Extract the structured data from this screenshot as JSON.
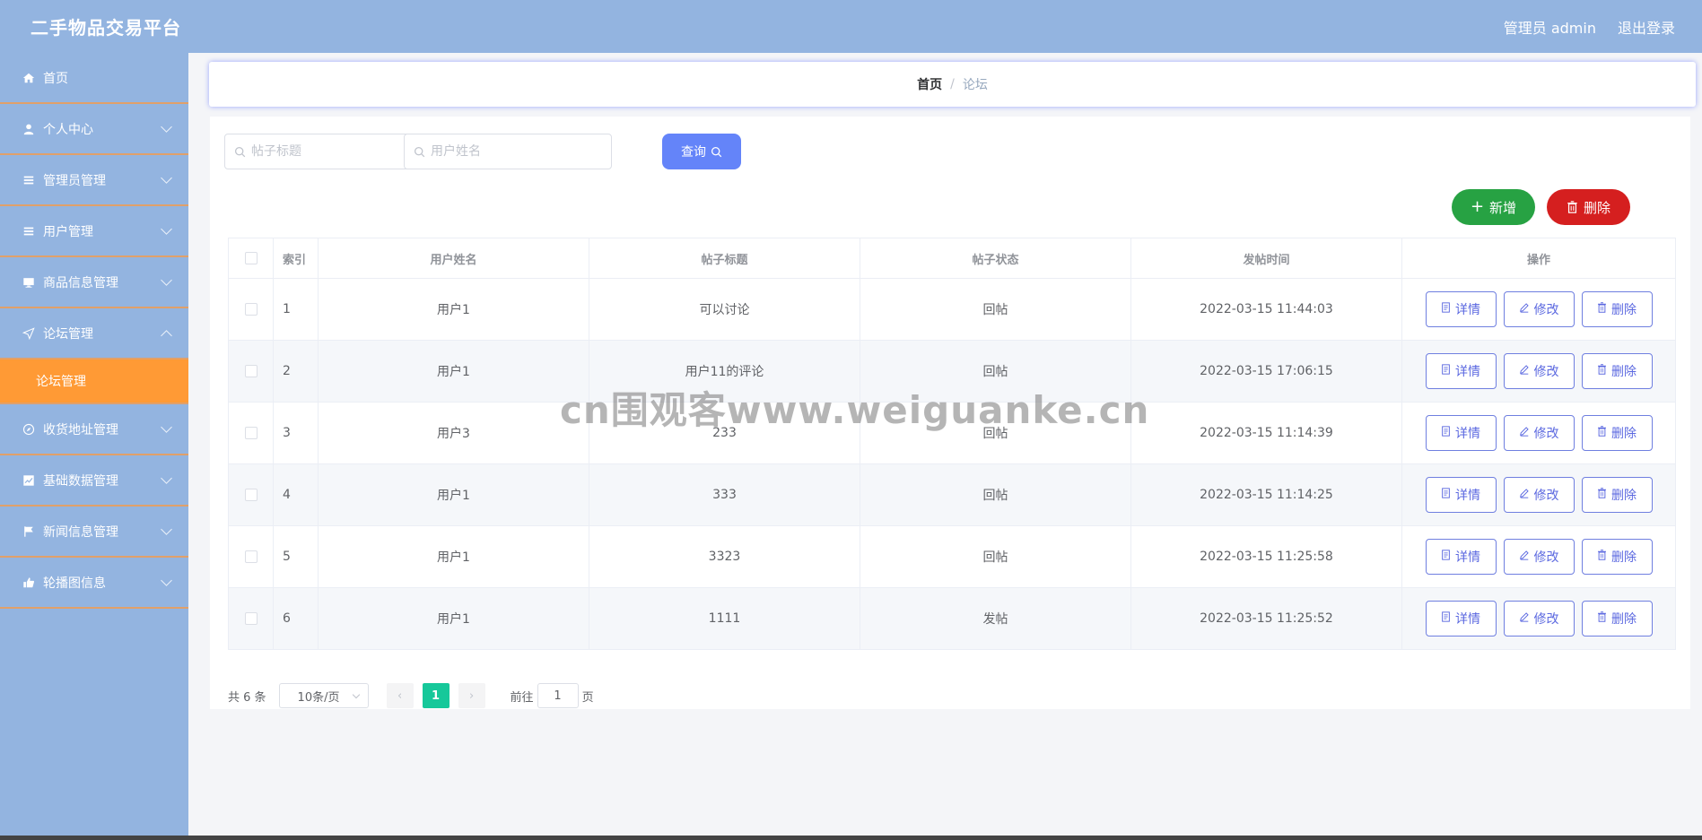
{
  "header": {
    "app_title": "二手物品交易平台",
    "user_label": "管理员 admin",
    "logout_label": "退出登录"
  },
  "sidebar": {
    "items": [
      {
        "label": "首页",
        "icon": "home-icon"
      },
      {
        "label": "个人中心",
        "icon": "user-icon"
      },
      {
        "label": "管理员管理",
        "icon": "list-icon"
      },
      {
        "label": "用户管理",
        "icon": "list-icon"
      },
      {
        "label": "商品信息管理",
        "icon": "monitor-icon"
      },
      {
        "label": "论坛管理",
        "icon": "send-icon",
        "expanded": true
      },
      {
        "label": "收货地址管理",
        "icon": "compass-icon"
      },
      {
        "label": "基础数据管理",
        "icon": "chart-icon"
      },
      {
        "label": "新闻信息管理",
        "icon": "flag-icon"
      },
      {
        "label": "轮播图信息",
        "icon": "thumb-icon"
      }
    ],
    "sub_item_active": "论坛管理"
  },
  "breadcrumb": {
    "home": "首页",
    "separator": "/",
    "current": "论坛"
  },
  "search": {
    "title_placeholder": "帖子标题",
    "user_placeholder": "用户姓名",
    "query_label": "查询"
  },
  "actions": {
    "add_label": "新增",
    "delete_label": "删除"
  },
  "table": {
    "headers": [
      "索引",
      "用户姓名",
      "帖子标题",
      "帖子状态",
      "发帖时间",
      "操作"
    ],
    "rows": [
      {
        "index": "1",
        "user": "用户1",
        "title": "可以讨论",
        "status": "回帖",
        "time": "2022-03-15 11:44:03"
      },
      {
        "index": "2",
        "user": "用户1",
        "title": "用户11的评论",
        "status": "回帖",
        "time": "2022-03-15 17:06:15"
      },
      {
        "index": "3",
        "user": "用户3",
        "title": "233",
        "status": "回帖",
        "time": "2022-03-15 11:14:39"
      },
      {
        "index": "4",
        "user": "用户1",
        "title": "333",
        "status": "回帖",
        "time": "2022-03-15 11:14:25"
      },
      {
        "index": "5",
        "user": "用户1",
        "title": "3323",
        "status": "回帖",
        "time": "2022-03-15 11:25:58"
      },
      {
        "index": "6",
        "user": "用户1",
        "title": "1111",
        "status": "发帖",
        "time": "2022-03-15 11:25:52"
      }
    ],
    "op_labels": {
      "detail": "详情",
      "edit": "修改",
      "delete": "删除"
    }
  },
  "pagination": {
    "total_text": "共 6 条",
    "page_size": "10条/页",
    "current_page": "1",
    "goto_prefix": "前往",
    "goto_value": "1",
    "goto_suffix": "页"
  },
  "watermark": "cn围观客www.weiguanke.cn",
  "colors": {
    "header_bg": "#93b4e0",
    "active_submenu": "#ff9a35",
    "query_button": "#6484f9",
    "add_button": "#27a243",
    "delete_button": "#d51f1f",
    "page_active": "#16c89a"
  }
}
